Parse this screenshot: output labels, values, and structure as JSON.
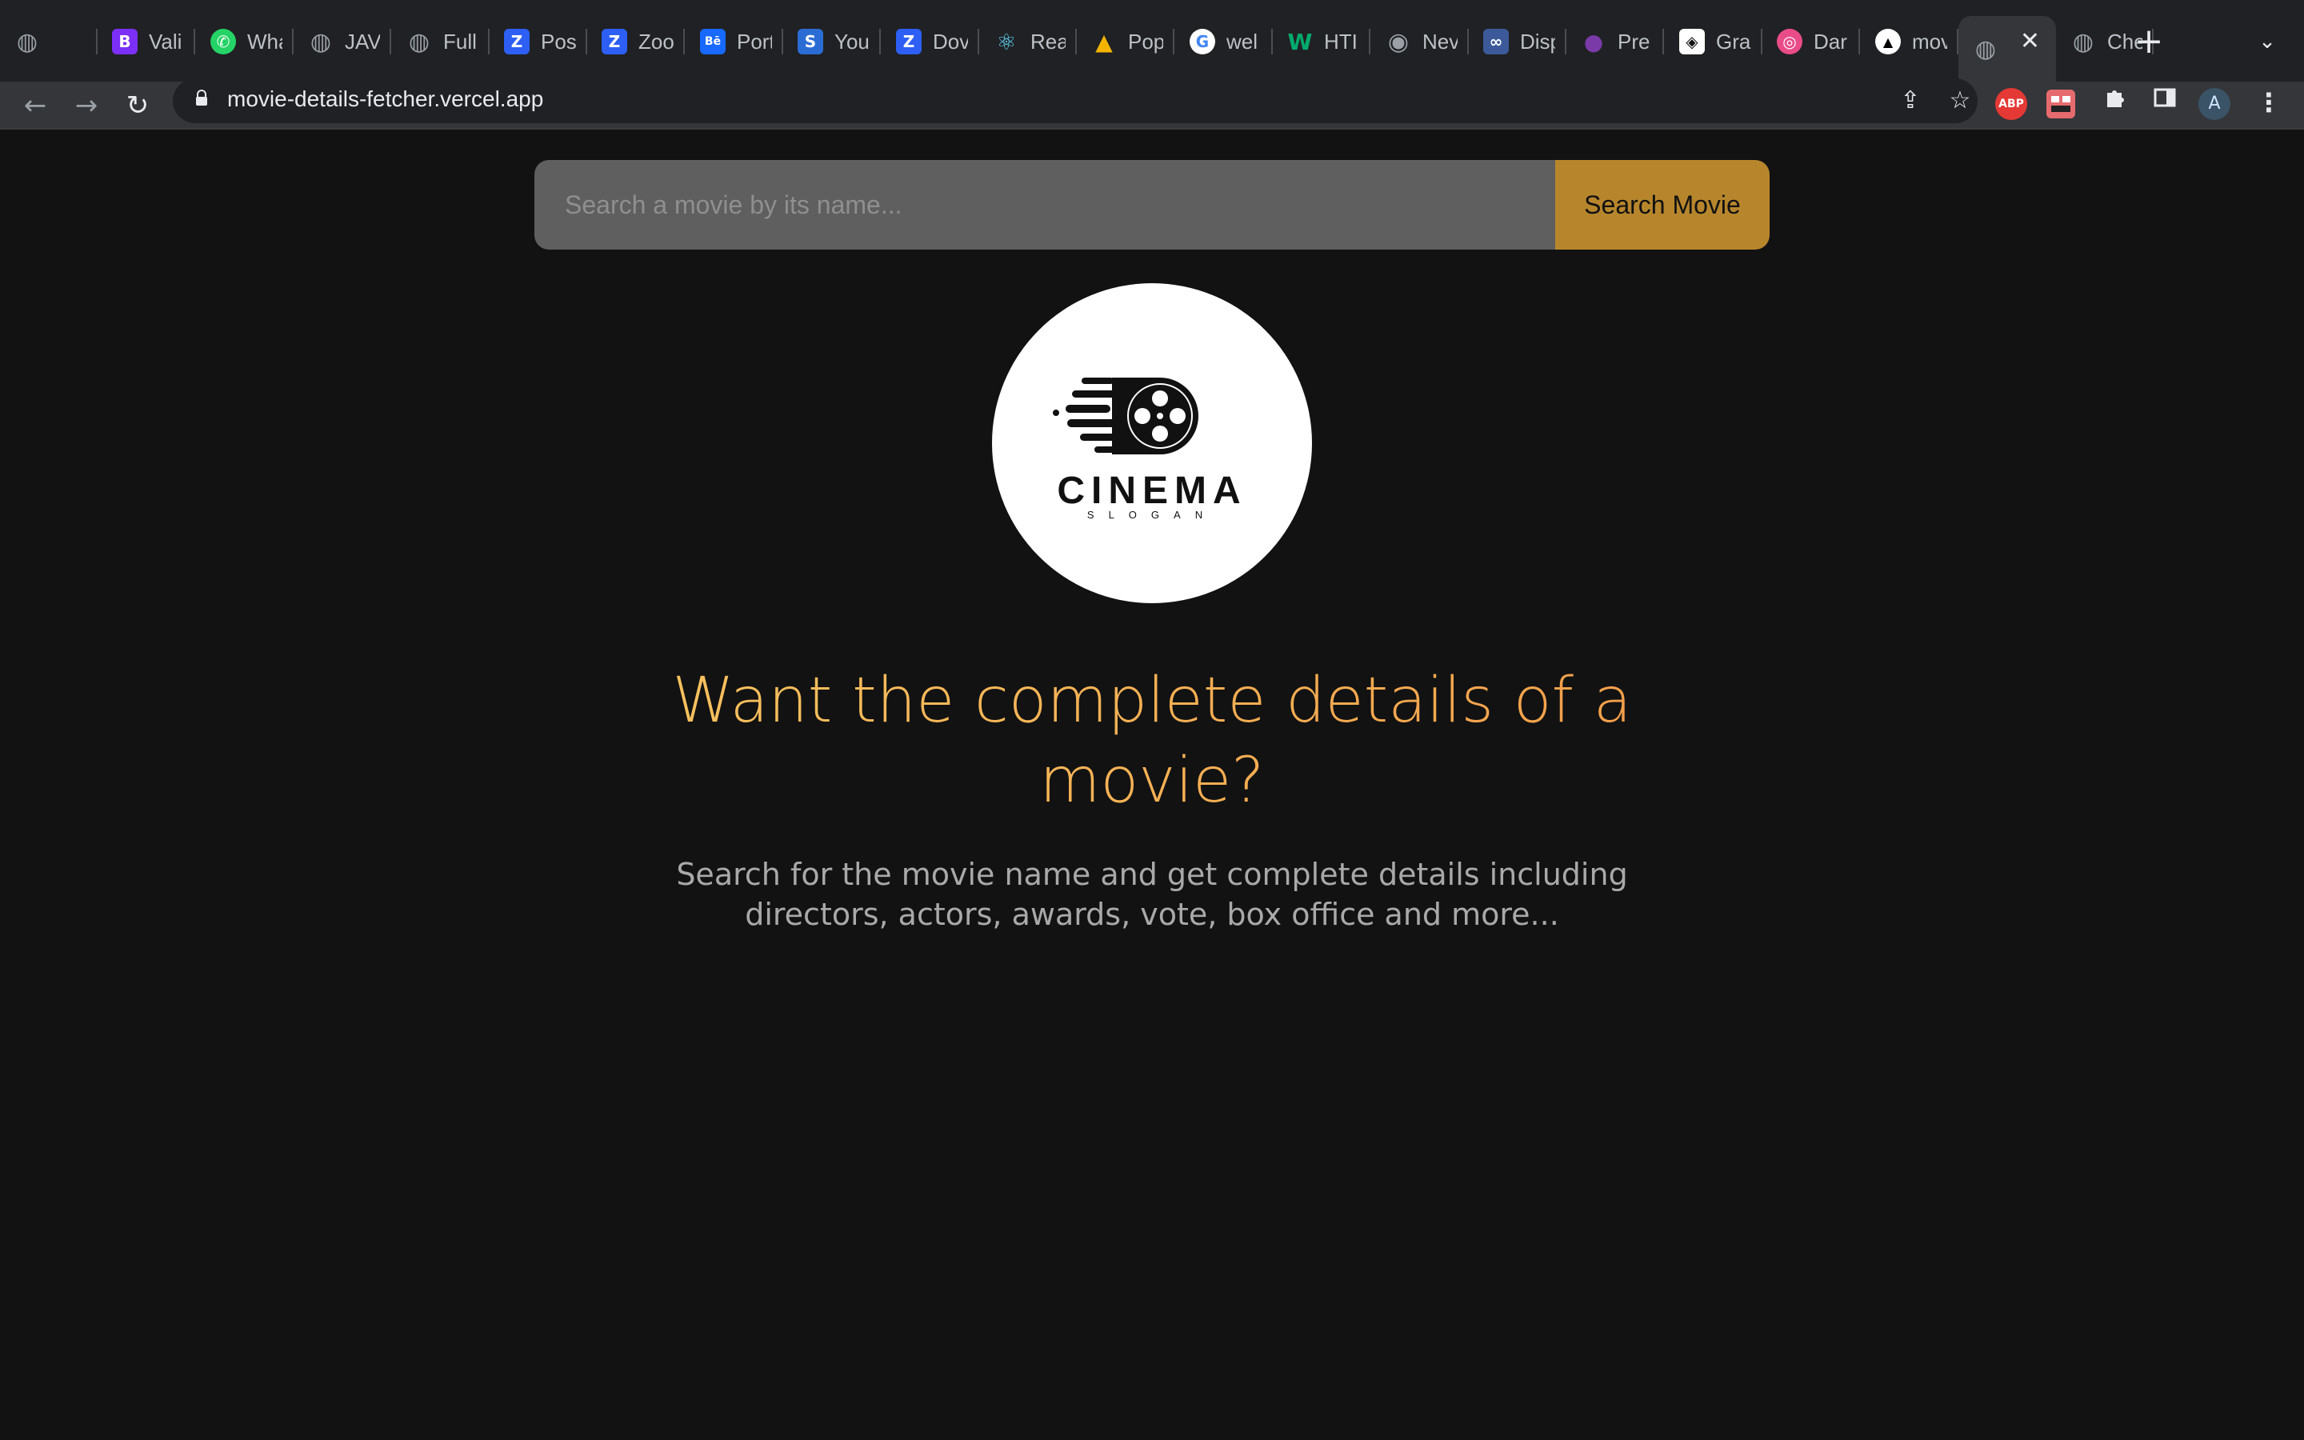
{
  "browser": {
    "tabs": [
      {
        "title": "",
        "icon": "globe-icon",
        "color": "#5f6368"
      },
      {
        "title": "Vali",
        "icon": "bootstrap-icon",
        "color": "#7b2ff7"
      },
      {
        "title": "Wha",
        "icon": "whatsapp-icon",
        "color": "#25d366"
      },
      {
        "title": "JAV",
        "icon": "globe-icon",
        "color": "#5f6368"
      },
      {
        "title": "Full",
        "icon": "globe-icon",
        "color": "#5f6368"
      },
      {
        "title": "Pos",
        "icon": "zoom-icon",
        "color": "#2d5ff5"
      },
      {
        "title": "Zoo",
        "icon": "zoom-icon",
        "color": "#2d5ff5"
      },
      {
        "title": "Port",
        "icon": "behance-icon",
        "color": "#1769ff"
      },
      {
        "title": "You",
        "icon": "s-icon",
        "color": "#2b6cd4"
      },
      {
        "title": "Dov",
        "icon": "zoom-icon",
        "color": "#2d5ff5"
      },
      {
        "title": "Rea",
        "icon": "react-icon",
        "color": "#61dafb"
      },
      {
        "title": "Pop",
        "icon": "popup-icon",
        "color": "#f4b400"
      },
      {
        "title": "wel",
        "icon": "google-icon",
        "color": "#ffffff"
      },
      {
        "title": "HTI",
        "icon": "w-icon",
        "color": "#04aa6d"
      },
      {
        "title": "Nev",
        "icon": "chrome-icon",
        "color": "#9aa0a6"
      },
      {
        "title": "Disp",
        "icon": "infinity-icon",
        "color": "#3c5a9a"
      },
      {
        "title": "Pre",
        "icon": "drop-icon",
        "color": "#7a3aa8"
      },
      {
        "title": "Gra",
        "icon": "codepen-icon",
        "color": "#ffffff"
      },
      {
        "title": "Dar",
        "icon": "dribbble-icon",
        "color": "#ea4c89"
      },
      {
        "title": "mov",
        "icon": "vercel-icon",
        "color": "#000000"
      },
      {
        "title": "",
        "icon": "globe-icon",
        "color": "#5f6368",
        "active": true
      },
      {
        "title": "Che",
        "icon": "globe-icon",
        "color": "#5f6368"
      }
    ],
    "close_glyph": "✕",
    "new_tab_glyph": "+",
    "tab_search_glyph": "⌄",
    "back_glyph": "←",
    "forward_glyph": "→",
    "reload_glyph": "↻",
    "url": "movie-details-fetcher.vercel.app",
    "share_glyph": "⇪",
    "star_glyph": "☆",
    "extensions": {
      "abp": "ABP",
      "avatar": "A"
    },
    "menu_glyph": "⋮"
  },
  "page": {
    "search": {
      "placeholder": "Search a movie by its name...",
      "value": "",
      "button_label": "Search Movie"
    },
    "logo": {
      "word": "CINEMA",
      "slogan": "SLOGAN"
    },
    "headline": "Want the complete details of a movie?",
    "subtext": "Search for the movie name and get complete details including directors, actors, awards, vote, box office and more..."
  },
  "colors": {
    "background": "#121212",
    "accent": "#b7862c",
    "headline_gradient_start": "#f7c15e",
    "headline_gradient_end": "#f3a04b"
  }
}
